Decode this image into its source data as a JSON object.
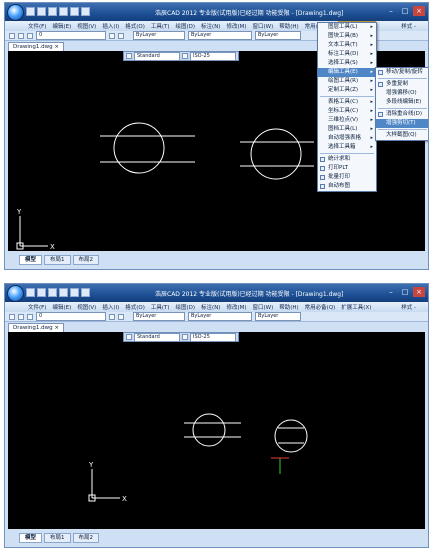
{
  "app": {
    "title": "浩辰CAD 2012 专业版(试用版)已经过期 功能受限 - [Drawing1.dwg]"
  },
  "menu": {
    "items": [
      "文件(F)",
      "编辑(E)",
      "视图(V)",
      "插入(I)",
      "格式(O)",
      "工具(T)",
      "绘图(D)",
      "标注(N)",
      "修改(M)",
      "窗口(W)",
      "帮助(H)",
      "常用必备(Q)",
      "扩展工具(X)"
    ],
    "style_label": "样式 -"
  },
  "toolbar": {
    "layer_value": "0",
    "linetype_value": "ByLayer",
    "lineweight_value": "ByLayer",
    "color_value": "ByLayer",
    "text_style": "Standard",
    "dim_style": "ISO-25"
  },
  "document": {
    "tab_label": "Drawing1.dwg"
  },
  "layout_tabs": [
    "模型",
    "布局1",
    "布局2"
  ],
  "axis": {
    "x_label": "X",
    "y_label": "Y"
  },
  "extend_menu": {
    "items": [
      {
        "label": "图层工具(L)",
        "arrow": true
      },
      {
        "label": "图块工具(B)",
        "arrow": true
      },
      {
        "label": "文本工具(T)",
        "arrow": true
      },
      {
        "label": "标注工具(D)",
        "arrow": true
      },
      {
        "label": "选择工具(S)",
        "arrow": true
      },
      {
        "label": "编辑工具(E)",
        "arrow": true,
        "highlight": true
      },
      {
        "label": "绘图工具(R)",
        "arrow": true
      },
      {
        "label": "定制工具(Z)",
        "arrow": true
      },
      {
        "label": "表格工具(C)",
        "arrow": true
      },
      {
        "label": "坐标工具(C)",
        "arrow": true
      },
      {
        "label": "三维拉点(V)",
        "arrow": true
      },
      {
        "label": "图档工具(L)",
        "arrow": true
      },
      {
        "label": "自动增强表格",
        "arrow": true
      },
      {
        "label": "选择工具箱",
        "arrow": true
      },
      {
        "label": "统计求和",
        "arrow": false
      },
      {
        "label": "打印PLT",
        "arrow": false
      },
      {
        "label": "批量打印",
        "arrow": false
      },
      {
        "label": "自动布图",
        "arrow": false
      }
    ]
  },
  "edit_submenu": {
    "items": [
      {
        "label": "移动/复制/旋转"
      },
      {
        "label": "多重复制"
      },
      {
        "label": "增强偏移(O)"
      },
      {
        "label": "多段线编辑(E)"
      },
      {
        "label": "消除重合线(D)"
      },
      {
        "label": "增强剪切(T)",
        "highlight": true
      },
      {
        "label": "大样截图(Q)"
      }
    ]
  },
  "colors": {
    "titlebar": "#1c4f94",
    "menu_highlight": "#4f86c6",
    "canvas": "#000000",
    "drawing_lines": "#ffffff",
    "axis_cursor_green": "#2fd12f",
    "axis_cursor_red": "#e23b3b"
  }
}
